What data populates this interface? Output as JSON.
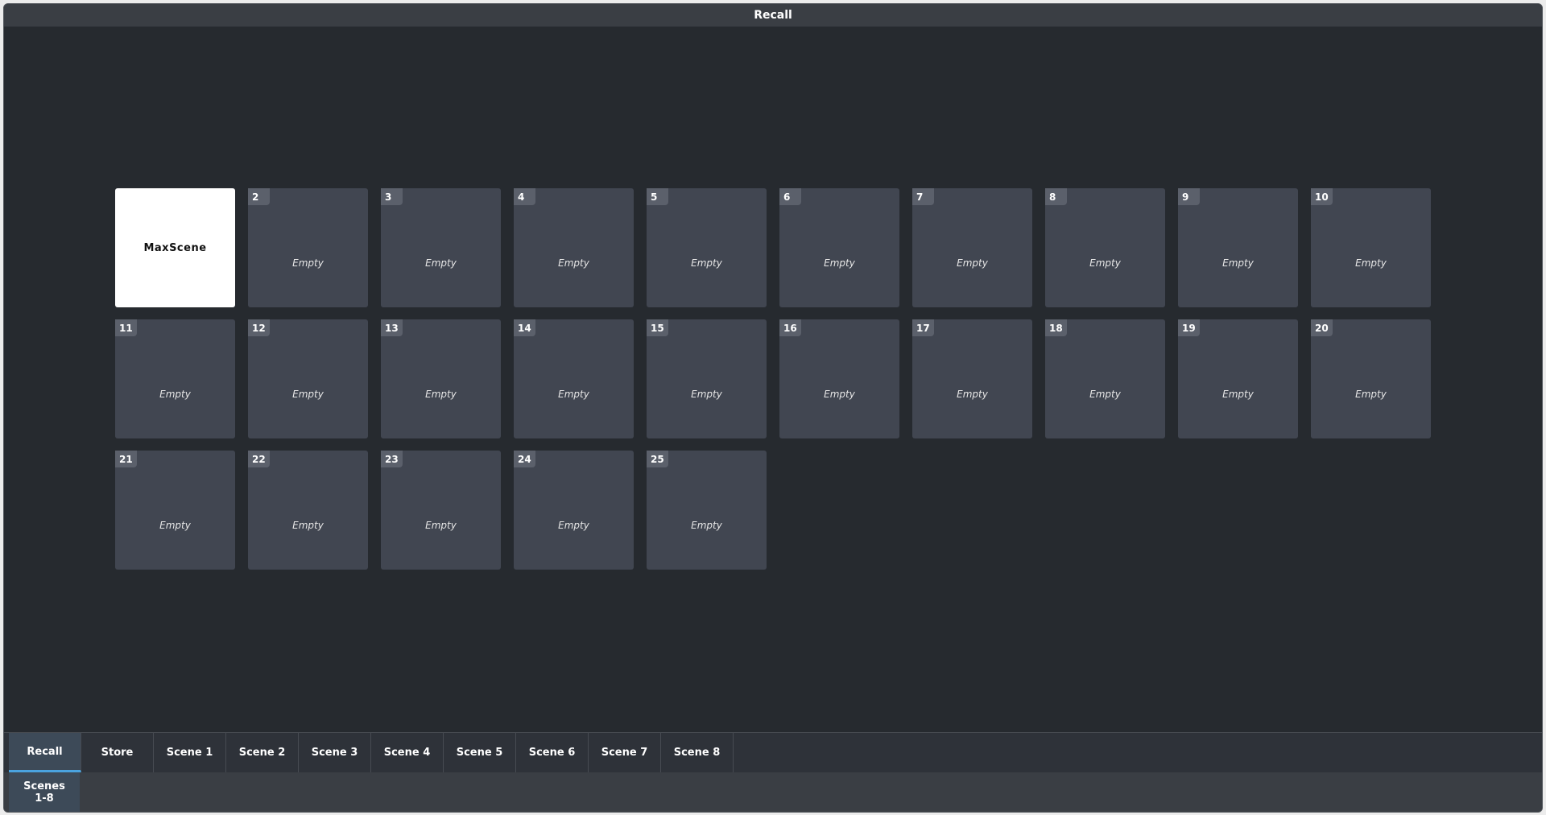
{
  "window": {
    "title": "Recall"
  },
  "scenes": [
    {
      "num": "",
      "label": "MaxScene",
      "active": true
    },
    {
      "num": "2",
      "label": "Empty"
    },
    {
      "num": "3",
      "label": "Empty"
    },
    {
      "num": "4",
      "label": "Empty"
    },
    {
      "num": "5",
      "label": "Empty"
    },
    {
      "num": "6",
      "label": "Empty"
    },
    {
      "num": "7",
      "label": "Empty"
    },
    {
      "num": "8",
      "label": "Empty"
    },
    {
      "num": "9",
      "label": "Empty"
    },
    {
      "num": "10",
      "label": "Empty"
    },
    {
      "num": "11",
      "label": "Empty"
    },
    {
      "num": "12",
      "label": "Empty"
    },
    {
      "num": "13",
      "label": "Empty"
    },
    {
      "num": "14",
      "label": "Empty"
    },
    {
      "num": "15",
      "label": "Empty"
    },
    {
      "num": "16",
      "label": "Empty"
    },
    {
      "num": "17",
      "label": "Empty"
    },
    {
      "num": "18",
      "label": "Empty"
    },
    {
      "num": "19",
      "label": "Empty"
    },
    {
      "num": "20",
      "label": "Empty"
    },
    {
      "num": "21",
      "label": "Empty"
    },
    {
      "num": "22",
      "label": "Empty"
    },
    {
      "num": "23",
      "label": "Empty"
    },
    {
      "num": "24",
      "label": "Empty"
    },
    {
      "num": "25",
      "label": "Empty"
    }
  ],
  "tabs": [
    {
      "label": "Recall",
      "selected": true
    },
    {
      "label": "Store"
    },
    {
      "label": "Scene 1"
    },
    {
      "label": "Scene 2"
    },
    {
      "label": "Scene 3"
    },
    {
      "label": "Scene 4"
    },
    {
      "label": "Scene 5"
    },
    {
      "label": "Scene 6"
    },
    {
      "label": "Scene 7"
    },
    {
      "label": "Scene 8"
    }
  ],
  "subtabs": [
    {
      "label": "Scenes\n1-8",
      "selected": true
    }
  ],
  "colors": {
    "background": "#262a2f",
    "tile": "#414651",
    "tile_active": "#ffffff",
    "tab_selected": "#3d4a58",
    "accent": "#4aa3df"
  }
}
